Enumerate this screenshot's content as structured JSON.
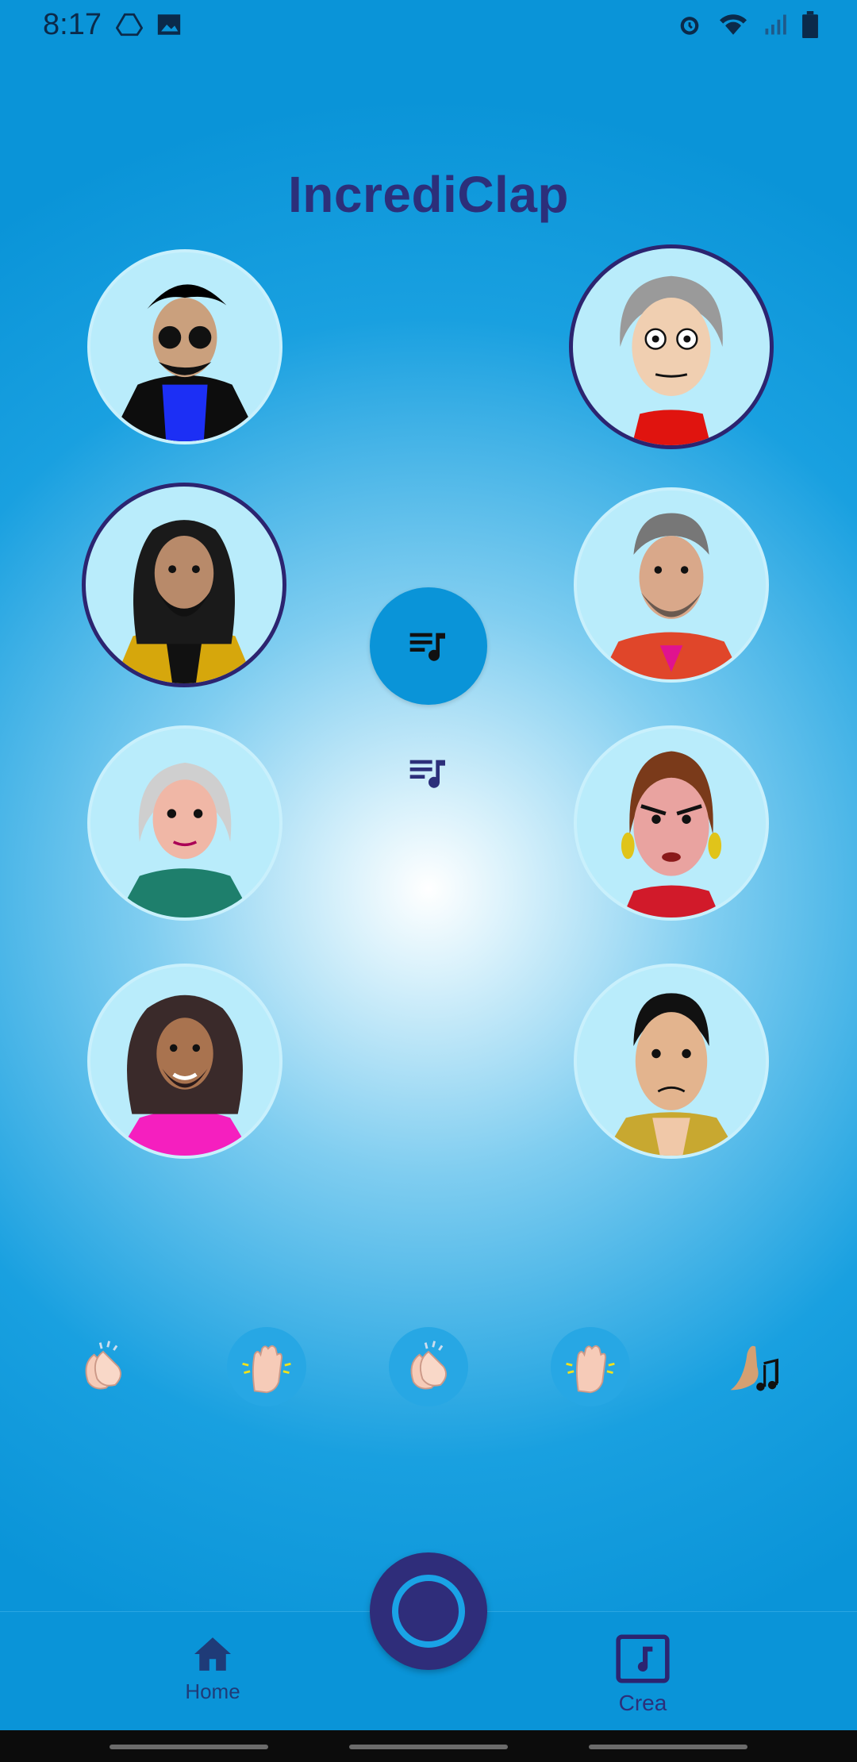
{
  "status": {
    "time": "8:17"
  },
  "app": {
    "title": "IncrediClap"
  },
  "avatars": [
    {
      "id": "a1",
      "selected": false
    },
    {
      "id": "a2",
      "selected": true
    },
    {
      "id": "a3",
      "selected": false
    },
    {
      "id": "a4",
      "selected": true
    },
    {
      "id": "a5",
      "selected": false
    },
    {
      "id": "a6",
      "selected": false
    },
    {
      "id": "a7",
      "selected": false
    },
    {
      "id": "a8",
      "selected": false
    }
  ],
  "controls": {
    "center_button_icon": "playlist-music-icon",
    "secondary_icon": "playlist-music-icon"
  },
  "claps": [
    {
      "icon": "clapping-hands-icon"
    },
    {
      "icon": "raised-hand-sparkle-icon"
    },
    {
      "icon": "clapping-hands-icon"
    },
    {
      "icon": "raised-hand-sparkle-icon"
    },
    {
      "icon": "heel-music-icon"
    }
  ],
  "nav": {
    "home_label": "Home",
    "create_label": "Crea"
  },
  "colors": {
    "background": "#0a94d8",
    "title": "#2c2f7a",
    "record_button": "#2f2d7a",
    "accent_ring": "#1aa3e6"
  }
}
